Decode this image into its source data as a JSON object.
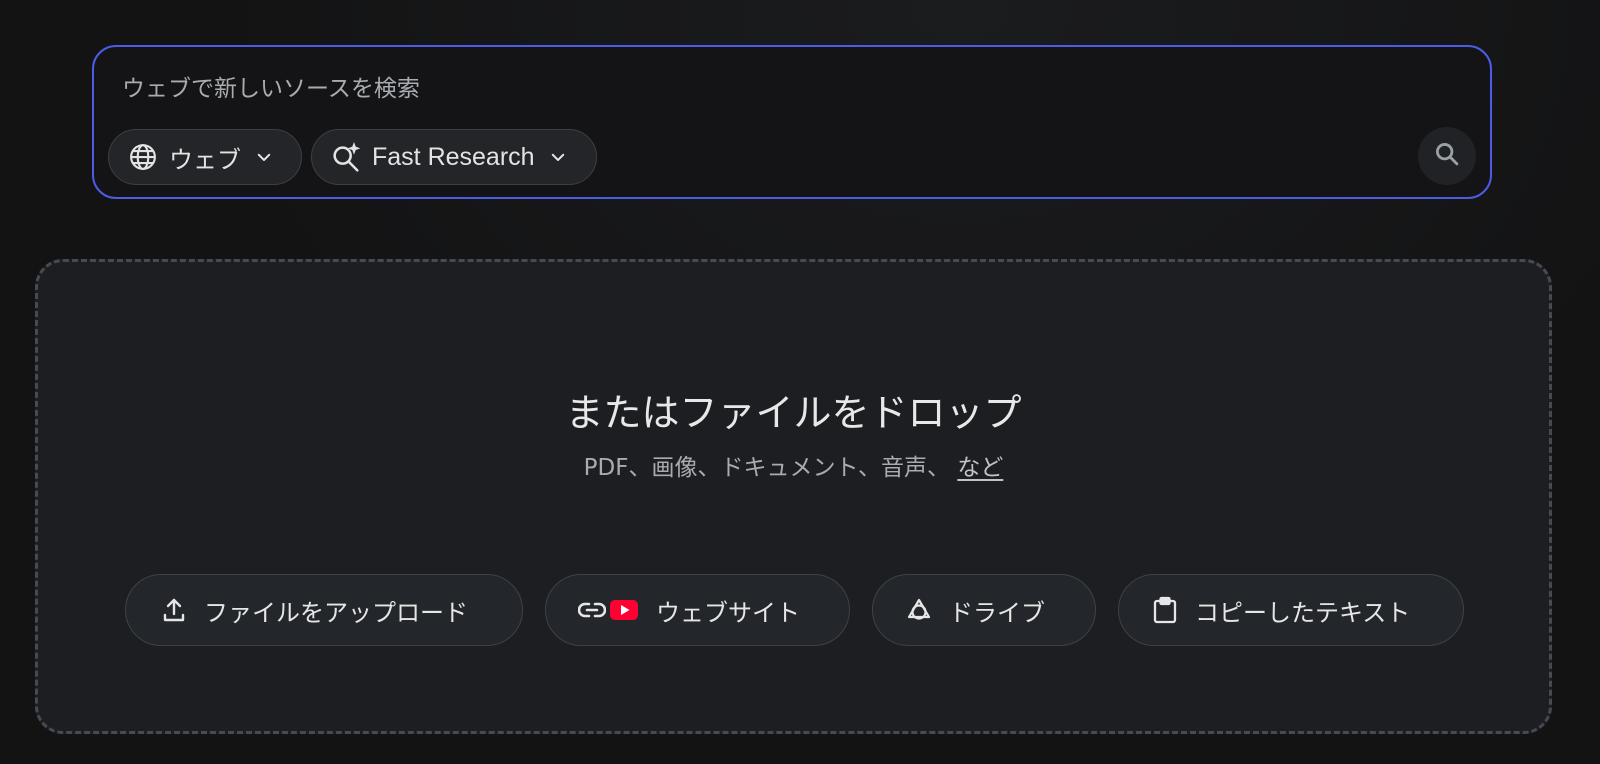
{
  "search": {
    "placeholder": "ウェブで新しいソースを検索",
    "value": "",
    "source_chip": {
      "label": "ウェブ",
      "icon": "globe-icon"
    },
    "mode_chip": {
      "label": "Fast Research",
      "icon": "sparkle-search-icon"
    },
    "submit_icon": "search-icon"
  },
  "drop_zone": {
    "title": "またはファイルをドロップ",
    "subtitle": "PDF、画像、ドキュメント、音声、",
    "more_link": "など"
  },
  "actions": {
    "upload": {
      "label": "ファイルをアップロード",
      "icon": "upload-icon"
    },
    "website": {
      "label": "ウェブサイト",
      "icons": [
        "link-icon",
        "youtube-icon"
      ]
    },
    "drive": {
      "label": "ドライブ",
      "icon": "drive-icon"
    },
    "copied_text": {
      "label": "コピーしたテキスト",
      "icon": "clipboard-icon"
    }
  },
  "colors": {
    "background": "#131314",
    "search_border": "#4c5ce6",
    "drop_zone_background": "#1c1e22",
    "youtube_red": "#ff0033"
  }
}
